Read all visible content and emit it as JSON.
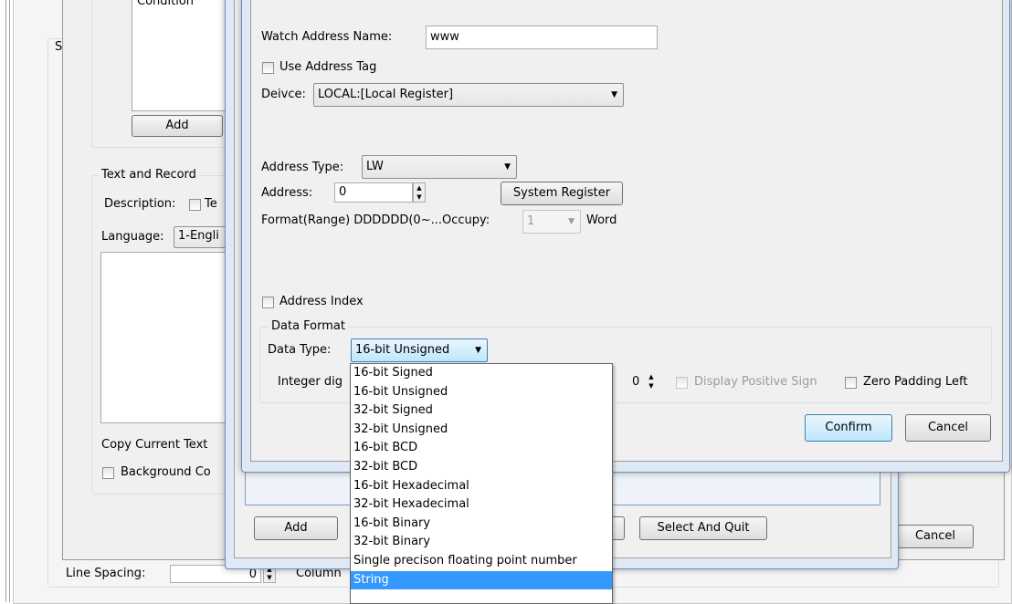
{
  "back_window": {
    "condition_header": "Condition",
    "add_button": "Add",
    "text_record_title": "Text and Record",
    "description_label": "Description:",
    "description_check_text": "Te",
    "language_label": "Language:",
    "language_value": "1-Engli",
    "copy_current_text": "Copy Current Text",
    "background_label": "Background Co",
    "side_label": "S",
    "line_spacing_label": "Line Spacing:",
    "line_spacing_value": "0",
    "column_label": "Column",
    "cancel_button": "Cancel"
  },
  "middle_window": {
    "add_button": "Add",
    "select_quit_button": "Select And Quit"
  },
  "dialog": {
    "watch_name_label": "Watch Address Name:",
    "watch_name_value": "www",
    "use_tag_label": "Use Address Tag",
    "device_label": "Deivce:",
    "device_value": "LOCAL:[Local Register]",
    "address_type_label": "Address Type:",
    "address_type_value": "LW",
    "address_label": "Address:",
    "address_value": "0",
    "system_register_button": "System Register",
    "format_range_label": "Format(Range) DDDDDD(0~...Occupy:",
    "occupy_value": "1",
    "word_label": "Word",
    "address_index_label": "Address Index",
    "data_format_title": "Data Format",
    "data_type_label": "Data Type:",
    "data_type_value": "16-bit Unsigned",
    "integer_digits_label": "Integer dig",
    "decimal_value": "0",
    "display_positive_label": "Display Positive Sign",
    "zero_padding_label": "Zero Padding Left",
    "confirm_button": "Confirm",
    "cancel_button": "Cancel"
  },
  "dropdown": {
    "items": [
      "16-bit Signed",
      "16-bit Unsigned",
      "32-bit Signed",
      "32-bit Unsigned",
      "16-bit BCD",
      "32-bit BCD",
      "16-bit Hexadecimal",
      "32-bit Hexadecimal",
      "16-bit Binary",
      "32-bit Binary",
      "Single precison floating point number",
      "String"
    ],
    "selected_index": 11
  },
  "colors": {
    "selection": "#3399ff",
    "frame": "#dfe9f5"
  }
}
